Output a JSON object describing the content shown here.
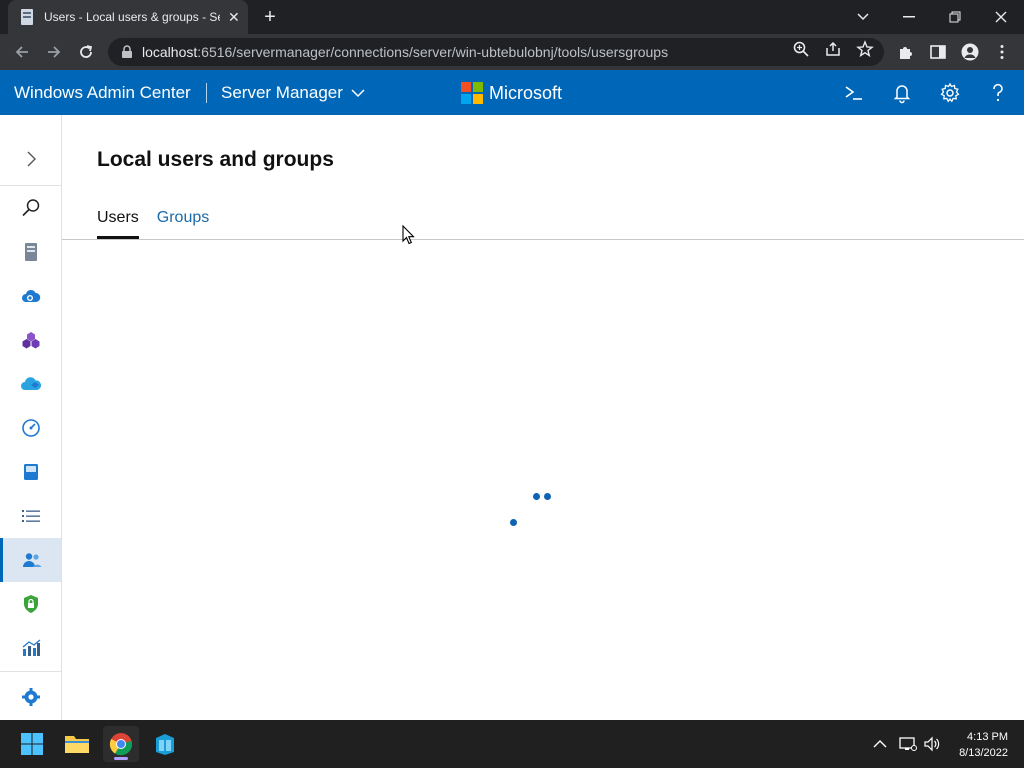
{
  "browser": {
    "tab_title": "Users - Local users & groups - Se",
    "url_host": "localhost",
    "url_rest": ":6516/servermanager/connections/server/win-ubtebulobnj/tools/usersgroups"
  },
  "header": {
    "app_title": "Windows Admin Center",
    "context_title": "Server Manager",
    "brand": "Microsoft"
  },
  "page": {
    "title": "Local users and groups",
    "tabs": [
      {
        "label": "Users",
        "active": true
      },
      {
        "label": "Groups",
        "active": false
      }
    ]
  },
  "sidebar": {
    "items": [
      {
        "icon": "expand-icon"
      },
      {
        "icon": "search-icon"
      },
      {
        "icon": "server-icon"
      },
      {
        "icon": "cloud-backup-icon"
      },
      {
        "icon": "containers-icon"
      },
      {
        "icon": "azure-cloud-icon"
      },
      {
        "icon": "performance-icon"
      },
      {
        "icon": "storage-icon"
      },
      {
        "icon": "list-icon"
      },
      {
        "icon": "users-icon",
        "active": true
      },
      {
        "icon": "security-shield-icon"
      },
      {
        "icon": "monitoring-chart-icon"
      },
      {
        "icon": "settings-gear-icon"
      }
    ]
  },
  "taskbar": {
    "time": "4:13 PM",
    "date": "8/13/2022"
  },
  "colors": {
    "accent": "#0067b8",
    "link": "#1a6aa8",
    "ms_red": "#f25022",
    "ms_green": "#7fba00",
    "ms_blue": "#00a4ef",
    "ms_yellow": "#ffb900"
  }
}
